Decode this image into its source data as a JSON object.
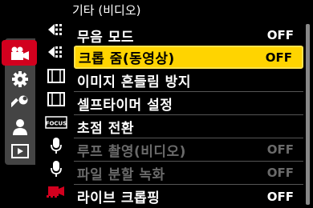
{
  "header": {
    "title": "기타 (비디오)"
  },
  "rail": [
    {
      "icon": "movie-camera-icon",
      "active": true
    },
    {
      "icon": "gear-icon"
    },
    {
      "icon": "wrench-icon"
    },
    {
      "icon": "person-icon"
    },
    {
      "icon": "playback-icon"
    }
  ],
  "menu": {
    "rows": [
      {
        "label": "무음 모드",
        "value": "OFF",
        "icon": "shutter-mode-icon",
        "selected": false,
        "disabled": false
      },
      {
        "label": "크롭 줌(동영상)",
        "value": "OFF",
        "icon": "shutter-mode-icon",
        "selected": true,
        "disabled": false
      },
      {
        "label": "이미지 흔들림 방지",
        "value": "",
        "icon": "film-frame-icon",
        "selected": false,
        "disabled": false
      },
      {
        "label": "셀프타이머 설정",
        "value": "",
        "icon": "film-frame-icon",
        "selected": false,
        "disabled": false
      },
      {
        "label": "초점 전환",
        "value": "",
        "icon": "focus-icon",
        "selected": false,
        "disabled": false
      },
      {
        "label": "루프 촬영(비디오)",
        "value": "OFF",
        "icon": "microphone-icon",
        "selected": false,
        "disabled": true
      },
      {
        "label": "파일 분할 녹화",
        "value": "OFF",
        "icon": "microphone-icon",
        "selected": false,
        "disabled": true
      },
      {
        "label": "라이브 크롭핑",
        "value": "OFF",
        "icon": "live-crop-icon",
        "selected": false,
        "disabled": false
      }
    ]
  },
  "icons": {
    "focus_label": "FOCUS"
  },
  "colors": {
    "accent": "#ffd400",
    "active_tab": "#d2001e",
    "disabled_text": "#6a6a6a"
  }
}
